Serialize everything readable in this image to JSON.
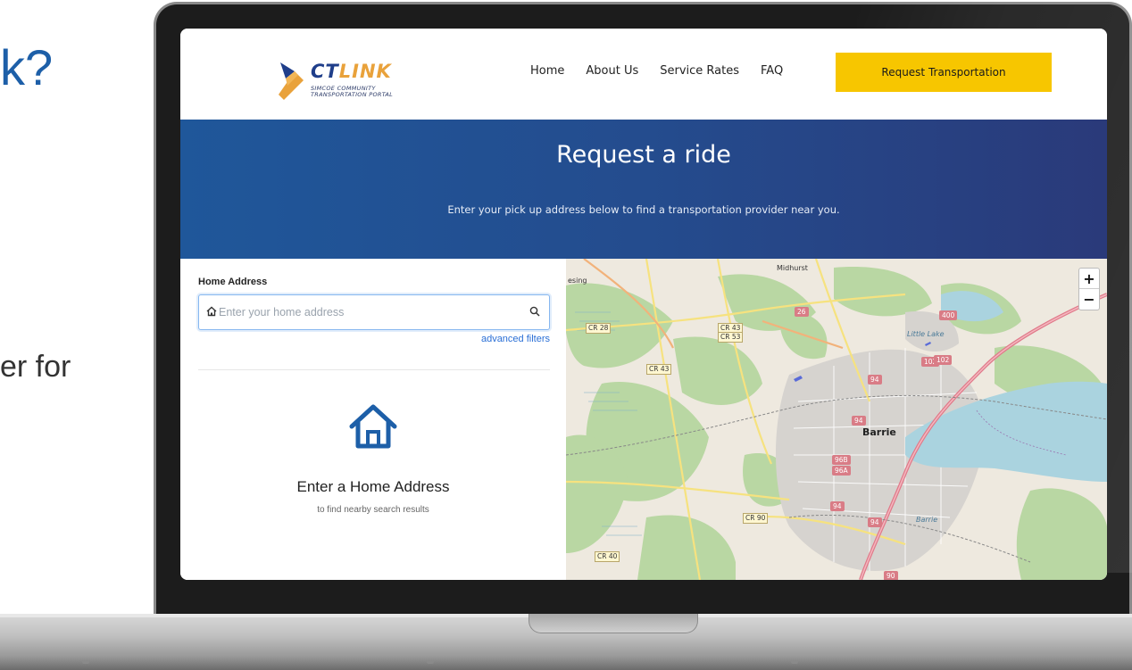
{
  "slide": {
    "title_fragment": "k?",
    "body_fragment": "er for"
  },
  "header": {
    "logo": {
      "word_ct": "CT",
      "word_link": "LINK",
      "tagline_line1": "SIMCOE COMMUNITY",
      "tagline_line2": "TRANSPORTATION PORTAL"
    },
    "nav": [
      "Home",
      "About Us",
      "Service Rates",
      "FAQ"
    ],
    "cta_label": "Request Transportation"
  },
  "hero": {
    "title": "Request a ride",
    "subtitle": "Enter your pick up address below to find a transportation provider near you."
  },
  "search": {
    "label": "Home Address",
    "placeholder": "Enter your home address",
    "value": "",
    "advanced_filters": "advanced filters"
  },
  "empty_state": {
    "title": "Enter a Home Address",
    "subtitle": "to find nearby search results"
  },
  "map": {
    "zoom_in": "+",
    "zoom_out": "−",
    "labels": {
      "midhurst": "Midhurst",
      "esing": "esing",
      "barrie": "Barrie",
      "little_lake": "Little Lake",
      "barrie_small": "Barrie"
    },
    "roads": {
      "cr28": "CR 28",
      "cr43a": "CR 43",
      "cr53": "CR 53",
      "cr43b": "CR 43",
      "cr90": "CR 90",
      "cr40": "CR 40",
      "r26": "26",
      "r400": "400",
      "r102a": "102",
      "r102b": "102",
      "r94a": "94",
      "r94b": "94",
      "r94c": "94",
      "r94d": "94",
      "r96b": "96B",
      "r96a": "96A",
      "r90": "90"
    }
  },
  "colors": {
    "hero_left": "#1f579a",
    "hero_right": "#2a3a7a",
    "cta": "#f7c600",
    "link": "#2a6fd6",
    "logo_navy": "#1f3e8a",
    "logo_orange": "#e9a23b"
  }
}
